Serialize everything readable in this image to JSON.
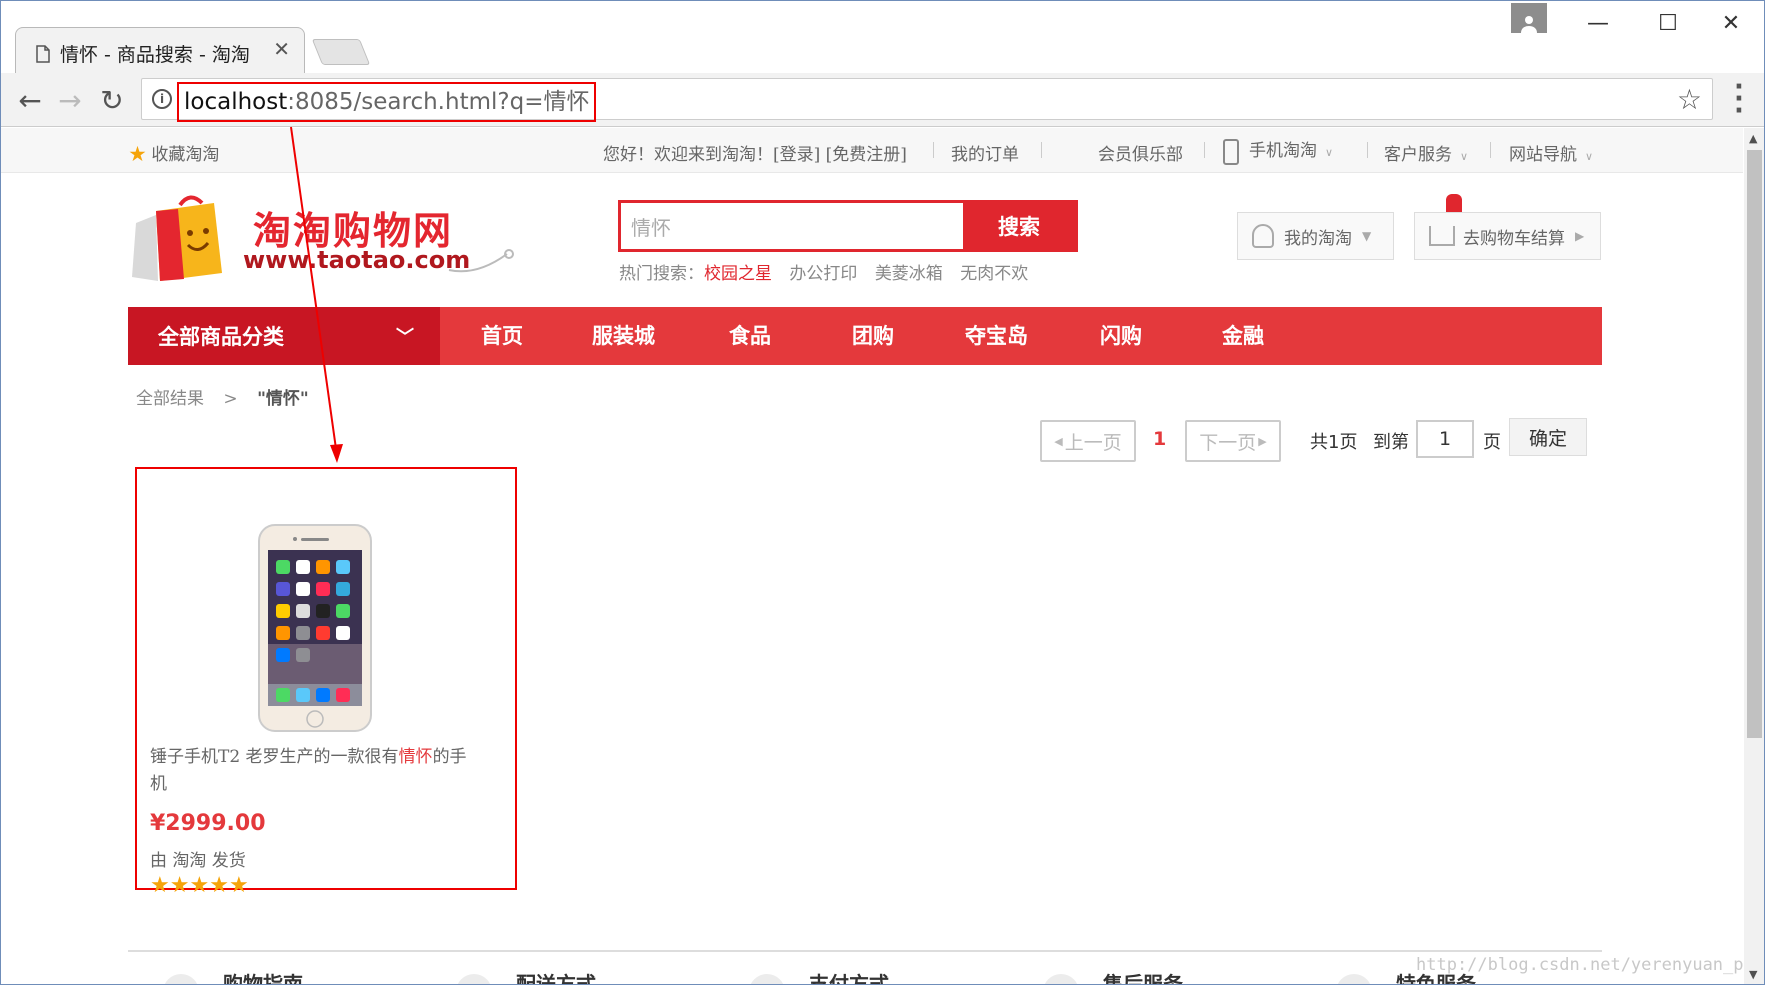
{
  "browser": {
    "tab_title": "情怀 - 商品搜索 - 淘淘",
    "url_host": "localhost",
    "url_rest": ":8085/search.html?q=情怀"
  },
  "topbar": {
    "favorite": "收藏淘淘",
    "welcome": "您好！欢迎来到淘淘！[登录] [免费注册]",
    "my_orders": "我的订单",
    "member_club": "会员俱乐部",
    "mobile": "手机淘淘",
    "service": "客户服务",
    "site_nav": "网站导航"
  },
  "header": {
    "logo_text": "淘淘购物网",
    "logo_url": "www.taotao.com",
    "search_value": "情怀",
    "search_button": "搜索",
    "hot_label": "热门搜索：",
    "hot_items": [
      "校园之星",
      "办公打印",
      "美菱冰箱",
      "无肉不欢"
    ],
    "my_taotao": "我的淘淘",
    "cart": "去购物车结算"
  },
  "nav": {
    "category": "全部商品分类",
    "links": [
      "首页",
      "服装城",
      "食品",
      "团购",
      "夺宝岛",
      "闪购",
      "金融"
    ]
  },
  "breadcrumb": {
    "root": "全部结果",
    "sep": ">",
    "current": "\"情怀\""
  },
  "pager": {
    "prev": "上一页",
    "current": "1",
    "next": "下一页",
    "total": "共1页",
    "goto": "到第",
    "page_value": "1",
    "page_unit": "页",
    "confirm": "确定"
  },
  "product": {
    "title_pre": "锤子手机T2 老罗生产的一款很有",
    "title_hl": "情怀",
    "title_post": "的手机",
    "price": "¥2999.00",
    "shipper": "由 淘淘 发货",
    "rating_stars": 5
  },
  "footer": {
    "items": [
      "购物指南",
      "配送方式",
      "支付方式",
      "售后服务",
      "特色服务"
    ]
  },
  "watermark": "http://blog.csdn.net/yerenyuan_pku",
  "colors": {
    "brand_red": "#e4393c",
    "category_red": "#c81623",
    "annotation_red": "#ee0000"
  }
}
